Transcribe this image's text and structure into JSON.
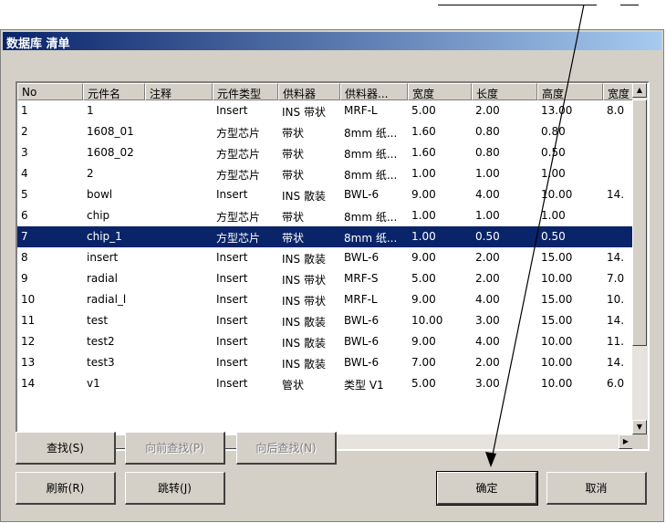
{
  "window": {
    "title": "数据库 清单"
  },
  "columns": [
    "No",
    "元件名",
    "注释",
    "元件类型",
    "供料器",
    "供料器...",
    "宽度",
    "长度",
    "高度",
    "宽度"
  ],
  "rows": [
    [
      "1",
      "1",
      "",
      "Insert",
      "INS 带状",
      "MRF-L",
      "5.00",
      "2.00",
      "13.00",
      "8.0"
    ],
    [
      "2",
      "1608_01",
      "",
      "方型芯片",
      "带状",
      "8mm 纸...",
      "1.60",
      "0.80",
      "0.80",
      ""
    ],
    [
      "3",
      "1608_02",
      "",
      "方型芯片",
      "带状",
      "8mm 纸...",
      "1.60",
      "0.80",
      "0.50",
      ""
    ],
    [
      "4",
      "2",
      "",
      "方型芯片",
      "带状",
      "8mm 纸...",
      "1.00",
      "1.00",
      "1.00",
      ""
    ],
    [
      "5",
      "bowl",
      "",
      "Insert",
      "INS 散装",
      "BWL-6",
      "9.00",
      "4.00",
      "10.00",
      "14."
    ],
    [
      "6",
      "chip",
      "",
      "方型芯片",
      "带状",
      "8mm 纸...",
      "1.00",
      "1.00",
      "1.00",
      ""
    ],
    [
      "7",
      "chip_1",
      "",
      "方型芯片",
      "带状",
      "8mm 纸...",
      "1.00",
      "0.50",
      "0.50",
      ""
    ],
    [
      "8",
      "insert",
      "",
      "Insert",
      "INS 散装",
      "BWL-6",
      "9.00",
      "2.00",
      "15.00",
      "14."
    ],
    [
      "9",
      "radial",
      "",
      "Insert",
      "INS 带状",
      "MRF-S",
      "5.00",
      "2.00",
      "10.00",
      "7.0"
    ],
    [
      "10",
      "radial_l",
      "",
      "Insert",
      "INS 带状",
      "MRF-L",
      "9.00",
      "4.00",
      "15.00",
      "10."
    ],
    [
      "11",
      "test",
      "",
      "Insert",
      "INS 散装",
      "BWL-6",
      "10.00",
      "3.00",
      "15.00",
      "14."
    ],
    [
      "12",
      "test2",
      "",
      "Insert",
      "INS 散装",
      "BWL-6",
      "9.00",
      "4.00",
      "10.00",
      "11."
    ],
    [
      "13",
      "test3",
      "",
      "Insert",
      "INS 散装",
      "BWL-6",
      "7.00",
      "2.00",
      "10.00",
      "14."
    ],
    [
      "14",
      "v1",
      "",
      "Insert",
      "管状",
      "类型 V1",
      "5.00",
      "3.00",
      "10.00",
      "6.0"
    ]
  ],
  "selected_row": 6,
  "buttons": {
    "find": "查找(S)",
    "find_prev": "向前查找(P)",
    "find_next": "向后查找(N)",
    "refresh": "刷新(R)",
    "jump": "跳转(J)",
    "ok": "确定",
    "cancel": "取消"
  },
  "colors": {
    "title_bar": "#0a246a",
    "selection": "#0a246a",
    "dialog_bg": "#d4d0c8"
  }
}
